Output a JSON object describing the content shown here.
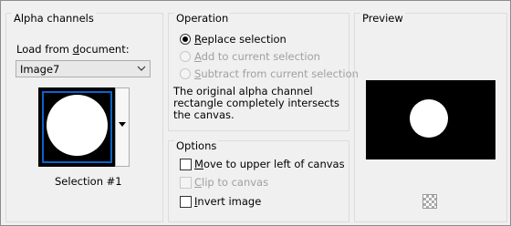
{
  "alpha": {
    "title": "Alpha channels",
    "load_label_pre": "Load from ",
    "load_label_u": "d",
    "load_label_post": "ocument:",
    "document_value": "Image7",
    "selection_name": "Selection #1"
  },
  "operation": {
    "title": "Operation",
    "options": [
      {
        "u": "R",
        "rest": "eplace selection",
        "checked": true,
        "enabled": true
      },
      {
        "u": "A",
        "rest": "dd to current selection",
        "checked": false,
        "enabled": false
      },
      {
        "u": "S",
        "rest": "ubtract from current selection",
        "checked": false,
        "enabled": false
      }
    ],
    "message": "The original alpha channel rectangle completely intersects the canvas."
  },
  "options": {
    "title": "Options",
    "items": [
      {
        "u": "M",
        "rest": "ove to upper left of canvas",
        "checked": false,
        "enabled": true
      },
      {
        "u": "C",
        "rest": "lip to canvas",
        "checked": false,
        "enabled": false
      },
      {
        "u": "I",
        "rest": "nvert image",
        "checked": false,
        "enabled": true
      }
    ]
  },
  "preview": {
    "title": "Preview",
    "transparency_icon": "checkerboard-icon"
  }
}
